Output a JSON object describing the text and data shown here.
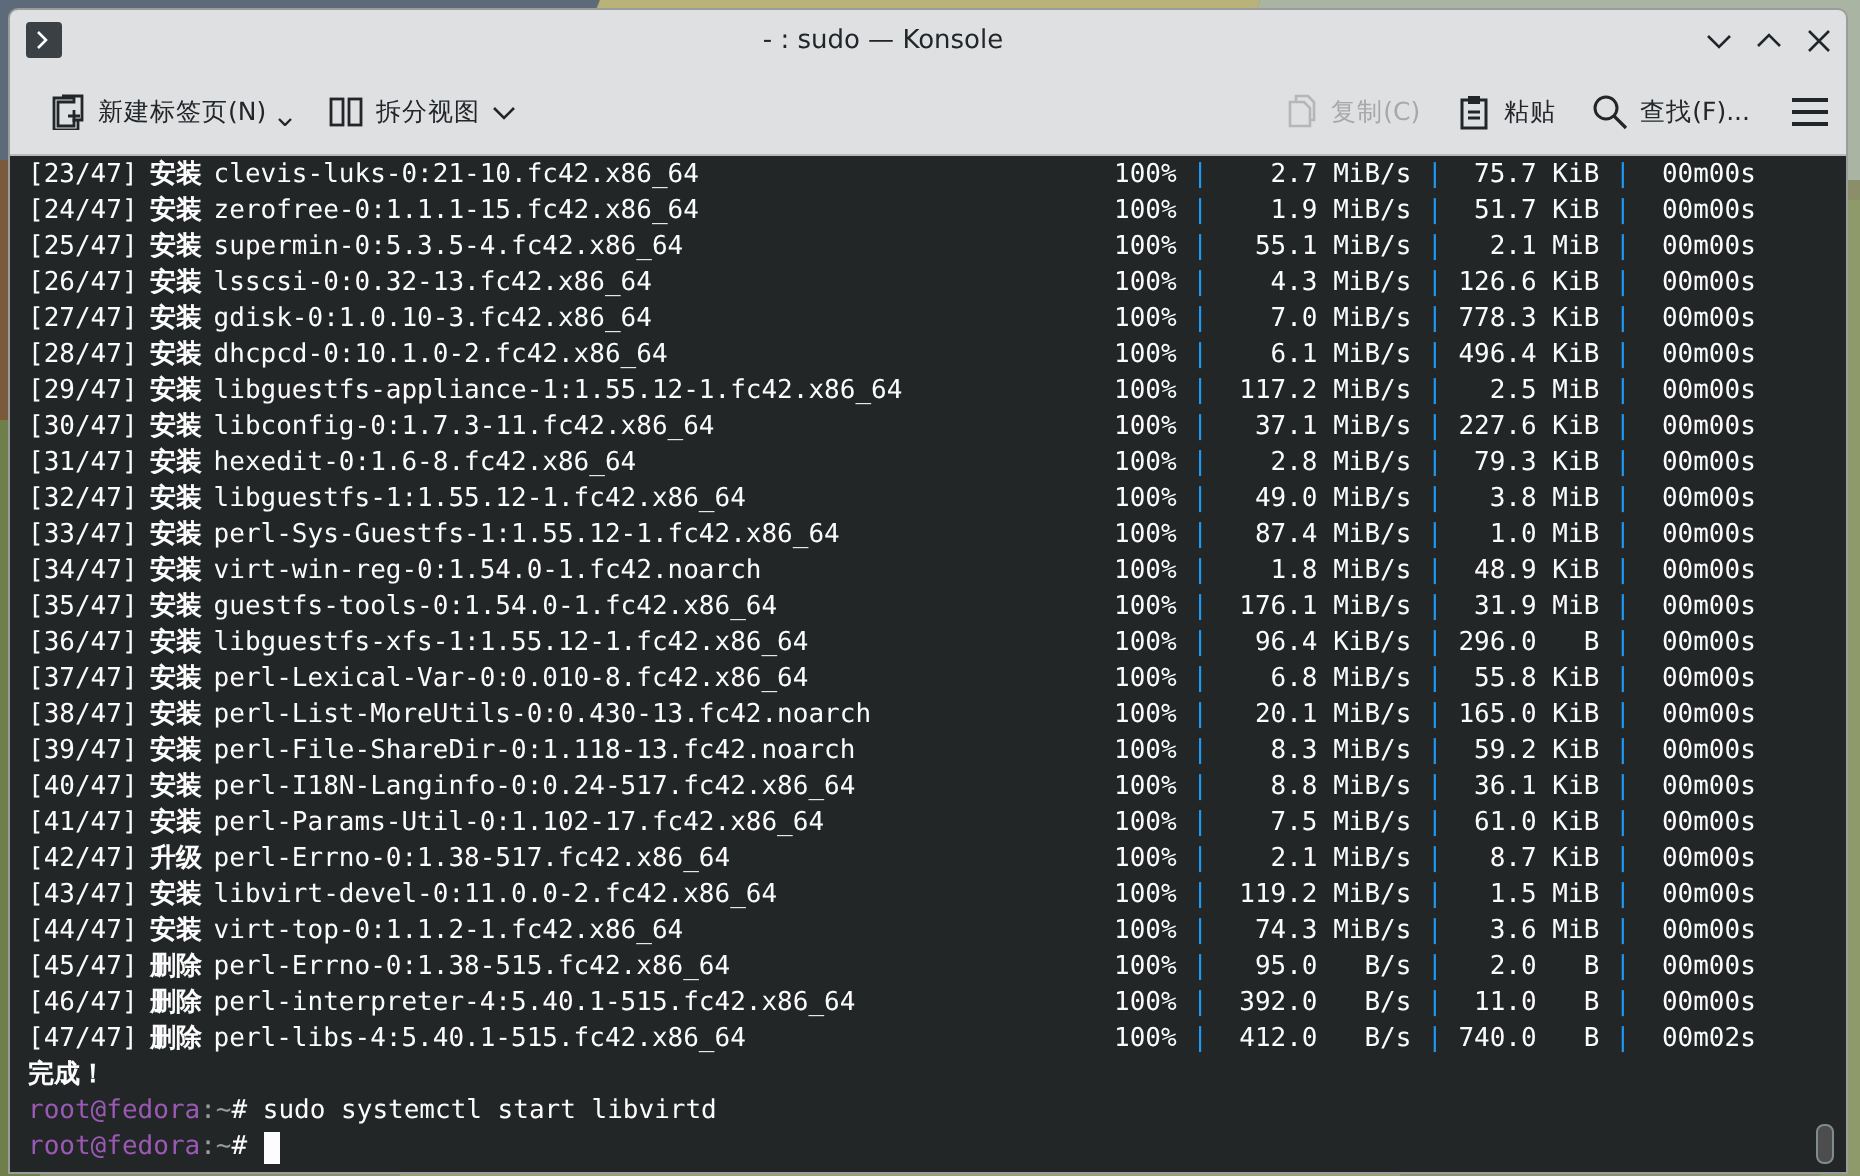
{
  "window": {
    "title": "- : sudo — Konsole"
  },
  "toolbar": {
    "left": [
      {
        "label": "新建标签页(N)",
        "kind": "new-tab",
        "disabled": false
      },
      {
        "label": "拆分视图",
        "kind": "split",
        "disabled": false
      }
    ],
    "right": [
      {
        "label": "复制(C)",
        "kind": "copy",
        "disabled": true
      },
      {
        "label": "粘贴",
        "kind": "paste",
        "disabled": false
      },
      {
        "label": "查找(F)...",
        "kind": "find",
        "disabled": false
      }
    ]
  },
  "terminal": {
    "rows": [
      {
        "index": "[23/47]",
        "action": "安装",
        "package": "clevis-luks-0:21-10.fc42.x86_64",
        "stats": "100% |    2.7 MiB/s |  75.7 KiB |  00m00s"
      },
      {
        "index": "[24/47]",
        "action": "安装",
        "package": "zerofree-0:1.1.1-15.fc42.x86_64",
        "stats": "100% |    1.9 MiB/s |  51.7 KiB |  00m00s"
      },
      {
        "index": "[25/47]",
        "action": "安装",
        "package": "supermin-0:5.3.5-4.fc42.x86_64",
        "stats": "100% |   55.1 MiB/s |   2.1 MiB |  00m00s"
      },
      {
        "index": "[26/47]",
        "action": "安装",
        "package": "lsscsi-0:0.32-13.fc42.x86_64",
        "stats": "100% |    4.3 MiB/s | 126.6 KiB |  00m00s"
      },
      {
        "index": "[27/47]",
        "action": "安装",
        "package": "gdisk-0:1.0.10-3.fc42.x86_64",
        "stats": "100% |    7.0 MiB/s | 778.3 KiB |  00m00s"
      },
      {
        "index": "[28/47]",
        "action": "安装",
        "package": "dhcpcd-0:10.1.0-2.fc42.x86_64",
        "stats": "100% |    6.1 MiB/s | 496.4 KiB |  00m00s"
      },
      {
        "index": "[29/47]",
        "action": "安装",
        "package": "libguestfs-appliance-1:1.55.12-1.fc42.x86_64",
        "stats": "100% |  117.2 MiB/s |   2.5 MiB |  00m00s"
      },
      {
        "index": "[30/47]",
        "action": "安装",
        "package": "libconfig-0:1.7.3-11.fc42.x86_64",
        "stats": "100% |   37.1 MiB/s | 227.6 KiB |  00m00s"
      },
      {
        "index": "[31/47]",
        "action": "安装",
        "package": "hexedit-0:1.6-8.fc42.x86_64",
        "stats": "100% |    2.8 MiB/s |  79.3 KiB |  00m00s"
      },
      {
        "index": "[32/47]",
        "action": "安装",
        "package": "libguestfs-1:1.55.12-1.fc42.x86_64",
        "stats": "100% |   49.0 MiB/s |   3.8 MiB |  00m00s"
      },
      {
        "index": "[33/47]",
        "action": "安装",
        "package": "perl-Sys-Guestfs-1:1.55.12-1.fc42.x86_64",
        "stats": "100% |   87.4 MiB/s |   1.0 MiB |  00m00s"
      },
      {
        "index": "[34/47]",
        "action": "安装",
        "package": "virt-win-reg-0:1.54.0-1.fc42.noarch",
        "stats": "100% |    1.8 MiB/s |  48.9 KiB |  00m00s"
      },
      {
        "index": "[35/47]",
        "action": "安装",
        "package": "guestfs-tools-0:1.54.0-1.fc42.x86_64",
        "stats": "100% |  176.1 MiB/s |  31.9 MiB |  00m00s"
      },
      {
        "index": "[36/47]",
        "action": "安装",
        "package": "libguestfs-xfs-1:1.55.12-1.fc42.x86_64",
        "stats": "100% |   96.4 KiB/s | 296.0   B |  00m00s"
      },
      {
        "index": "[37/47]",
        "action": "安装",
        "package": "perl-Lexical-Var-0:0.010-8.fc42.x86_64",
        "stats": "100% |    6.8 MiB/s |  55.8 KiB |  00m00s"
      },
      {
        "index": "[38/47]",
        "action": "安装",
        "package": "perl-List-MoreUtils-0:0.430-13.fc42.noarch",
        "stats": "100% |   20.1 MiB/s | 165.0 KiB |  00m00s"
      },
      {
        "index": "[39/47]",
        "action": "安装",
        "package": "perl-File-ShareDir-0:1.118-13.fc42.noarch",
        "stats": "100% |    8.3 MiB/s |  59.2 KiB |  00m00s"
      },
      {
        "index": "[40/47]",
        "action": "安装",
        "package": "perl-I18N-Langinfo-0:0.24-517.fc42.x86_64",
        "stats": "100% |    8.8 MiB/s |  36.1 KiB |  00m00s"
      },
      {
        "index": "[41/47]",
        "action": "安装",
        "package": "perl-Params-Util-0:1.102-17.fc42.x86_64",
        "stats": "100% |    7.5 MiB/s |  61.0 KiB |  00m00s"
      },
      {
        "index": "[42/47]",
        "action": "升级",
        "package": "perl-Errno-0:1.38-517.fc42.x86_64",
        "stats": "100% |    2.1 MiB/s |   8.7 KiB |  00m00s"
      },
      {
        "index": "[43/47]",
        "action": "安装",
        "package": "libvirt-devel-0:11.0.0-2.fc42.x86_64",
        "stats": "100% |  119.2 MiB/s |   1.5 MiB |  00m00s"
      },
      {
        "index": "[44/47]",
        "action": "安装",
        "package": "virt-top-0:1.1.2-1.fc42.x86_64",
        "stats": "100% |   74.3 MiB/s |   3.6 MiB |  00m00s"
      },
      {
        "index": "[45/47]",
        "action": "删除",
        "package": "perl-Errno-0:1.38-515.fc42.x86_64",
        "stats": "100% |   95.0   B/s |   2.0   B |  00m00s"
      },
      {
        "index": "[46/47]",
        "action": "删除",
        "package": "perl-interpreter-4:5.40.1-515.fc42.x86_64",
        "stats": "100% |  392.0   B/s |  11.0   B |  00m00s"
      },
      {
        "index": "[47/47]",
        "action": "删除",
        "package": "perl-libs-4:5.40.1-515.fc42.x86_64",
        "stats": "100% |  412.0   B/s | 740.0   B |  00m02s"
      }
    ],
    "done": "完成！",
    "prompts": [
      {
        "user_host": "root@fedora",
        "path": ":~",
        "symbol": "#",
        "command": "sudo systemctl start libvirtd",
        "cursor": false
      },
      {
        "user_host": "root@fedora",
        "path": ":~",
        "symbol": "#",
        "cursor": true
      }
    ]
  }
}
